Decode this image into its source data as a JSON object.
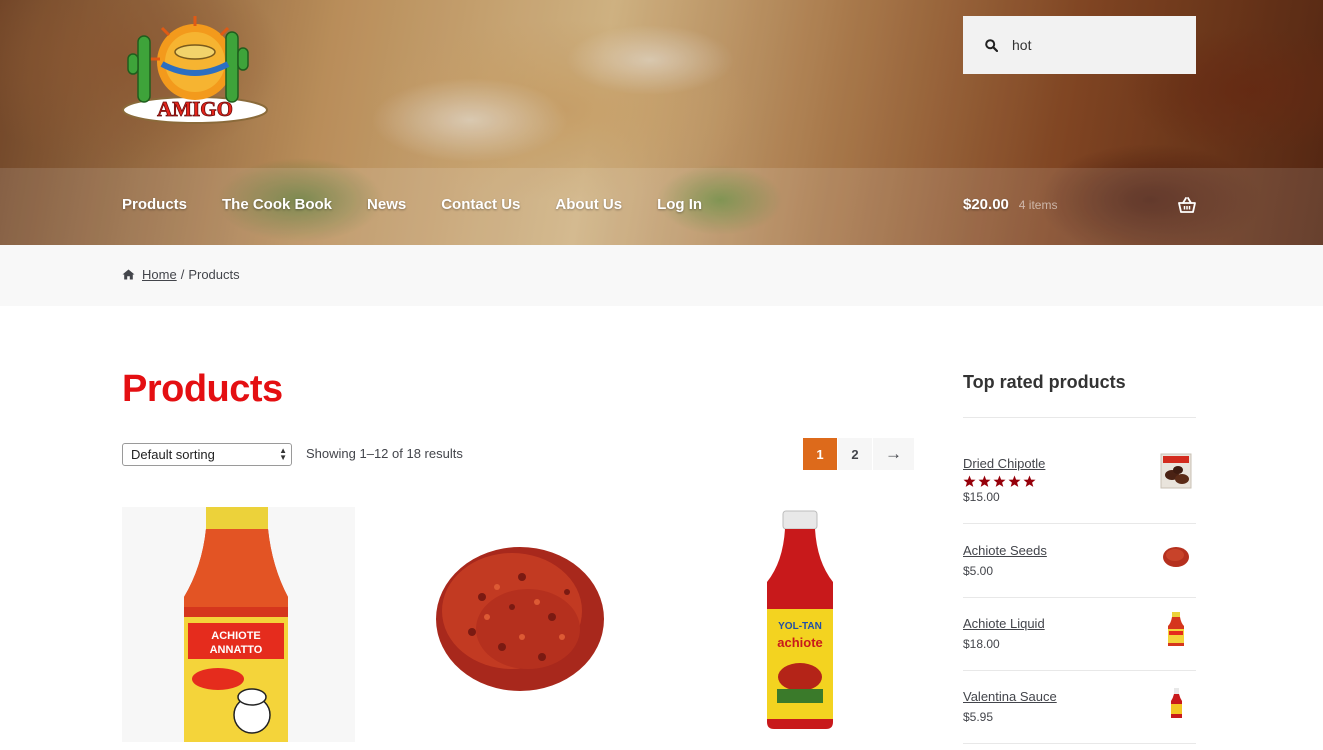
{
  "header": {
    "logo_text": "AMIGO",
    "search": {
      "value": "hot",
      "icon": "search-icon"
    },
    "nav": [
      "Products",
      "The Cook Book",
      "News",
      "Contact Us",
      "About Us",
      "Log In"
    ],
    "cart": {
      "amount": "$20.00",
      "count": "4 items",
      "icon": "basket-icon"
    }
  },
  "breadcrumb": {
    "icon": "home-icon",
    "home": "Home",
    "separator": "/",
    "current": "Products"
  },
  "main": {
    "title": "Products",
    "sorting": "Default sorting",
    "result_count": "Showing 1–12 of 18 results",
    "pagination": {
      "pages": [
        "1",
        "2"
      ],
      "current": "1",
      "next": "→"
    },
    "products": [
      {
        "image": "achiote-annatto-liquid-bottle"
      },
      {
        "image": "achiote-seeds-pile"
      },
      {
        "image": "yol-tan-achiote-bottle"
      }
    ]
  },
  "sidebar": {
    "title": "Top rated products",
    "items": [
      {
        "name": "Dried Chipotle",
        "price": "$15.00",
        "rating": 5
      },
      {
        "name": "Achiote Seeds",
        "price": "$5.00"
      },
      {
        "name": "Achiote Liquid",
        "price": "$18.00"
      },
      {
        "name": "Valentina Sauce",
        "price": "$5.95"
      }
    ]
  },
  "colors": {
    "title_red": "#e40f12",
    "pager_current": "#dd6a1b",
    "star": "#96000a"
  }
}
